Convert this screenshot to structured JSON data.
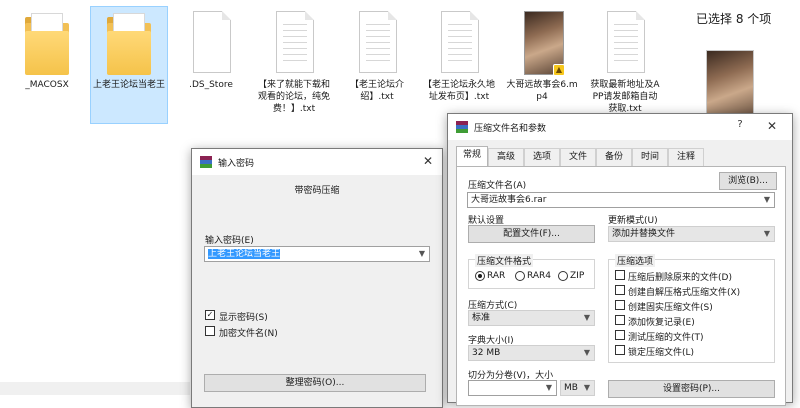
{
  "explorer": {
    "selection_status": "已选择 8 个项",
    "files": [
      {
        "name": "_MACOSX",
        "type": "folder",
        "selected": false
      },
      {
        "name": "上老王论坛当老王",
        "type": "folder",
        "selected": true
      },
      {
        "name": ".DS_Store",
        "type": "document",
        "selected": false
      },
      {
        "name": "【来了就能下载和观看的论坛，纯免费！】.txt",
        "type": "text",
        "selected": false
      },
      {
        "name": "【老王论坛介绍】.txt",
        "type": "text",
        "selected": false
      },
      {
        "name": "【老王论坛永久地址发布页】.txt",
        "type": "text",
        "selected": false
      },
      {
        "name": "大哥远故事会6.mp4",
        "type": "video",
        "selected": false
      },
      {
        "name": "获取最新地址及APP请发邮箱自动获取.txt",
        "type": "text",
        "selected": false
      }
    ]
  },
  "password_dialog": {
    "title": "输入密码",
    "heading": "带密码压缩",
    "password_label": "输入密码(E)",
    "password_value": "上老王论坛当老王",
    "show_password_label": "显示密码(S)",
    "show_password_checked": true,
    "encrypt_names_label": "加密文件名(N)",
    "encrypt_names_checked": false,
    "organize_button": "整理密码(O)..."
  },
  "rar_dialog": {
    "title": "压缩文件名和参数",
    "help": "?",
    "tabs": [
      "常规",
      "高级",
      "选项",
      "文件",
      "备份",
      "时间",
      "注释"
    ],
    "active_tab": "常规",
    "archive_name_label": "压缩文件名(A)",
    "browse_button": "浏览(B)...",
    "archive_name_value": "大哥远故事会6.rar",
    "default_settings_label": "默认设置",
    "profiles_button": "配置文件(F)...",
    "update_mode_label": "更新模式(U)",
    "update_mode_value": "添加并替换文件",
    "format_group": "压缩文件格式",
    "formats": [
      "RAR",
      "RAR4",
      "ZIP"
    ],
    "selected_format": "RAR",
    "method_label": "压缩方式(C)",
    "method_value": "标准",
    "dict_label": "字典大小(I)",
    "dict_value": "32 MB",
    "split_label": "切分为分卷(V)，大小",
    "split_unit": "MB",
    "options_group": "压缩选项",
    "options": [
      {
        "label": "压缩后删除原来的文件(D)",
        "checked": false
      },
      {
        "label": "创建自解压格式压缩文件(X)",
        "checked": false
      },
      {
        "label": "创建固实压缩文件(S)",
        "checked": false
      },
      {
        "label": "添加恢复记录(E)",
        "checked": false
      },
      {
        "label": "测试压缩的文件(T)",
        "checked": false
      },
      {
        "label": "锁定压缩文件(L)",
        "checked": false
      }
    ],
    "set_password_button": "设置密码(P)..."
  },
  "colors": {
    "selection_bg": "#cce8ff",
    "dialog_bg": "#f0f0f0",
    "highlight": "#3399ff",
    "folder": "#f5c34a"
  }
}
